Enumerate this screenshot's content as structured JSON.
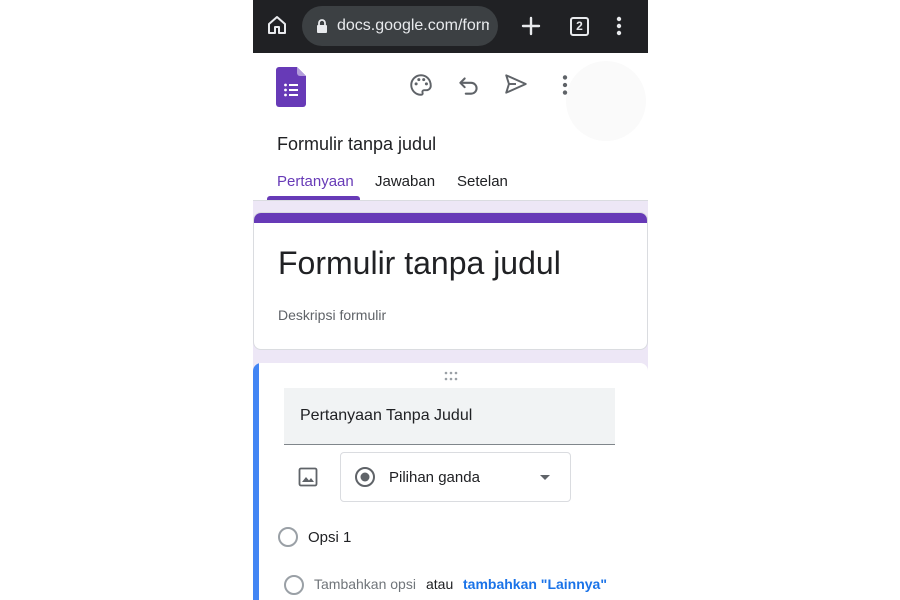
{
  "browser": {
    "url": "docs.google.com/forms",
    "tab_count": "2",
    "icons": [
      "home-icon",
      "lock-icon",
      "plus-icon",
      "tabs-icon",
      "menu-icon"
    ]
  },
  "header": {
    "doc_title": "Formulir tanpa judul",
    "tabs": [
      {
        "label": "Pertanyaan",
        "active": true
      },
      {
        "label": "Jawaban",
        "active": false
      },
      {
        "label": "Setelan",
        "active": false
      }
    ],
    "icons": [
      "forms-logo-icon",
      "palette-icon",
      "undo-icon",
      "send-icon",
      "more-icon"
    ]
  },
  "title_card": {
    "title": "Formulir tanpa judul",
    "description_placeholder": "Deskripsi formulir"
  },
  "question": {
    "title": "Pertanyaan Tanpa Judul",
    "type": "Pilihan ganda",
    "options": [
      "Opsi 1"
    ],
    "add_option": "Tambahkan opsi",
    "or_text": "atau",
    "add_other": "tambahkan \"Lainnya\""
  },
  "colors": {
    "brand": "#673ab7",
    "accent": "#4285f4",
    "link": "#1a73e8",
    "background": "#ede7f6"
  }
}
